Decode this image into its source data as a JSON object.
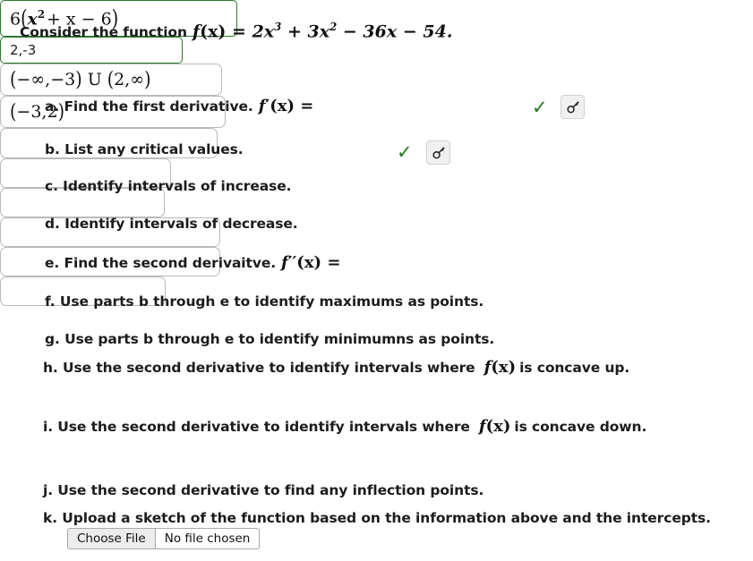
{
  "prompt": {
    "lead": "Consider the function",
    "fn_name": "f",
    "fn_arg": "(x)",
    "equals": "=",
    "expr_a": "2x",
    "exp_a": "3",
    "plus": "+",
    "expr_b": "3x",
    "exp_b": "2",
    "minus1": "−",
    "expr_c": "36x",
    "minus2": "−",
    "expr_d": "54."
  },
  "items": {
    "a": {
      "label": "a. Find the first derivative.",
      "math_fn": "f",
      "math_prime": "′",
      "math_arg": "(x)",
      "math_eq": "=",
      "value_lead": "6",
      "value_inner_x": "x",
      "value_inner_exp": "2",
      "value_inner_rest": "+ x − 6",
      "status": "correct",
      "check_glyph": "✓",
      "key_icon": "key-icon"
    },
    "b": {
      "label": "b. List any critical values.",
      "value": "2,-3",
      "status": "correct",
      "check_glyph": "✓",
      "key_icon": "key-icon"
    },
    "c": {
      "label": "c. Identify intervals of increase.",
      "value_left": "−∞,−3",
      "value_union": "U",
      "value_right": "2,∞",
      "status": "unanswered"
    },
    "d": {
      "label": "d. Identify intervals of decrease.",
      "value": "−3,2",
      "status": "unanswered"
    },
    "e": {
      "label": "e. Find the second derivaitve.",
      "math_fn": "f",
      "math_prime": "′′",
      "math_arg": "(x)",
      "math_eq": "=",
      "value": "",
      "status": "empty"
    },
    "f": {
      "label": "f. Use parts b through e to identify maximums as points.",
      "value": "",
      "status": "empty"
    },
    "g": {
      "label": "g. Use parts b through e to identify minimumns as points.",
      "value": "",
      "status": "empty"
    },
    "h": {
      "label_pre": "h. Use the second derivative to identify intervals where",
      "label_math_fn": "f",
      "label_math_arg": "(x)",
      "label_post": "is concave up.",
      "value": "",
      "status": "empty"
    },
    "i": {
      "label_pre": "i. Use the second derivative to identify intervals where",
      "label_math_fn": "f",
      "label_math_arg": "(x)",
      "label_post": "is concave down.",
      "value": "",
      "status": "empty"
    },
    "j": {
      "label": "j. Use the second derivative to find any inflection points.",
      "value": "",
      "status": "empty"
    },
    "k": {
      "label": "k. Upload a sketch of the function based on the information above and the intercepts.",
      "choose_file_label": "Choose File",
      "file_status": "No file chosen"
    }
  },
  "colors": {
    "correct_border": "#2c7a2c",
    "check": "#1d7a1d",
    "neutral_border": "#b9b9b9",
    "text": "#1c1c1c",
    "background": "#ffffff",
    "key_button_bg": "#f0f0f0"
  }
}
